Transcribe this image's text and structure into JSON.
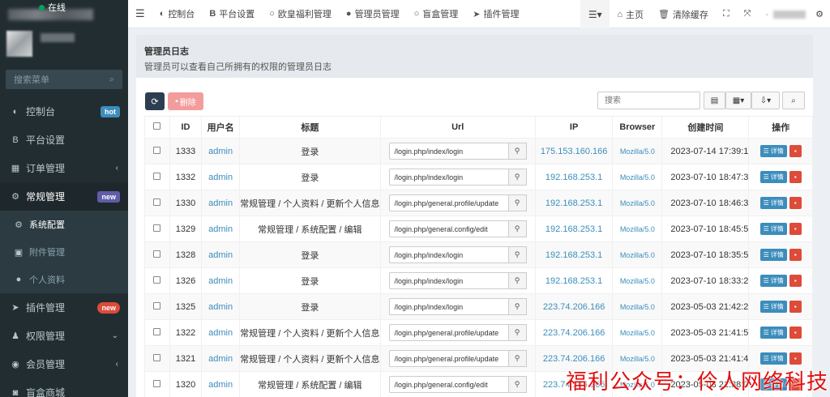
{
  "sidebar": {
    "status": "在线",
    "search_placeholder": "搜索菜单",
    "items": [
      {
        "icon": "dashboard-icon",
        "glyph": "◐",
        "label": "控制台",
        "badge": "hot"
      },
      {
        "icon": "bold-icon",
        "glyph": "B",
        "label": "平台设置"
      },
      {
        "icon": "table-icon",
        "glyph": "▦",
        "label": "订单管理",
        "caret": "‹"
      },
      {
        "icon": "cogs-icon",
        "glyph": "⚙",
        "label": "常规管理",
        "badge": "new"
      },
      {
        "icon": "cog-icon",
        "glyph": "⚙",
        "label": "系统配置",
        "sub": true,
        "current": true
      },
      {
        "icon": "file-image-icon",
        "glyph": "▣",
        "label": "附件管理",
        "sub": true
      },
      {
        "icon": "user-icon",
        "glyph": "●",
        "label": "个人资料",
        "sub": true
      },
      {
        "icon": "rocket-icon",
        "glyph": "➤",
        "label": "插件管理",
        "badge": "new"
      },
      {
        "icon": "group-icon",
        "glyph": "♟",
        "label": "权限管理",
        "caret": "⌄"
      },
      {
        "icon": "user-circle-icon",
        "glyph": "◉",
        "label": "会员管理",
        "caret": "‹"
      },
      {
        "icon": "shop-icon",
        "glyph": "◙",
        "label": "盲盒商城"
      }
    ]
  },
  "topnav": {
    "items": [
      {
        "icon": "dashboard-icon",
        "glyph": "◐",
        "label": "控制台"
      },
      {
        "icon": "bold-icon",
        "glyph": "B",
        "label": "平台设置"
      },
      {
        "icon": "circle-icon",
        "glyph": "○",
        "label": "欧皇福利管理"
      },
      {
        "icon": "user-icon",
        "glyph": "●",
        "label": "管理员管理"
      },
      {
        "icon": "circle-icon",
        "glyph": "○",
        "label": "盲盒管理"
      },
      {
        "icon": "rocket-icon",
        "glyph": "➤",
        "label": "插件管理"
      }
    ],
    "home_label": "主页",
    "clear_cache_label": "清除缓存"
  },
  "page": {
    "title": "管理员日志",
    "subtitle": "管理员可以查看自己所拥有的权限的管理员日志"
  },
  "toolbar": {
    "delete_label": "删除",
    "search_placeholder": "搜索"
  },
  "table": {
    "headers": [
      "ID",
      "用户名",
      "标题",
      "Url",
      "IP",
      "Browser",
      "创建时间",
      "操作"
    ],
    "detail_label": "详情",
    "rows": [
      {
        "id": "1333",
        "user": "admin",
        "title": "登录",
        "url": "/login.php/index/login",
        "ip": "175.153.160.166",
        "browser": "Mozilla/5.0",
        "time": "2023-07-14 17:39:1"
      },
      {
        "id": "1332",
        "user": "admin",
        "title": "登录",
        "url": "/login.php/index/login",
        "ip": "192.168.253.1",
        "browser": "Mozilla/5.0",
        "time": "2023-07-10 18:47:3"
      },
      {
        "id": "1330",
        "user": "admin",
        "title": "常规管理 / 个人资料 / 更新个人信息",
        "url": "/login.php/general.profile/update",
        "ip": "192.168.253.1",
        "browser": "Mozilla/5.0",
        "time": "2023-07-10 18:46:3"
      },
      {
        "id": "1329",
        "user": "admin",
        "title": "常规管理 / 系统配置 / 编辑",
        "url": "/login.php/general.config/edit",
        "ip": "192.168.253.1",
        "browser": "Mozilla/5.0",
        "time": "2023-07-10 18:45:5"
      },
      {
        "id": "1328",
        "user": "admin",
        "title": "登录",
        "url": "/login.php/index/login",
        "ip": "192.168.253.1",
        "browser": "Mozilla/5.0",
        "time": "2023-07-10 18:35:5"
      },
      {
        "id": "1326",
        "user": "admin",
        "title": "登录",
        "url": "/login.php/index/login",
        "ip": "192.168.253.1",
        "browser": "Mozilla/5.0",
        "time": "2023-07-10 18:33:2"
      },
      {
        "id": "1325",
        "user": "admin",
        "title": "登录",
        "url": "/login.php/index/login",
        "ip": "223.74.206.166",
        "browser": "Mozilla/5.0",
        "time": "2023-05-03 21:42:2"
      },
      {
        "id": "1322",
        "user": "admin",
        "title": "常规管理 / 个人资料 / 更新个人信息",
        "url": "/login.php/general.profile/update",
        "ip": "223.74.206.166",
        "browser": "Mozilla/5.0",
        "time": "2023-05-03 21:41:5"
      },
      {
        "id": "1321",
        "user": "admin",
        "title": "常规管理 / 个人资料 / 更新个人信息",
        "url": "/login.php/general.profile/update",
        "ip": "223.74.206.166",
        "browser": "Mozilla/5.0",
        "time": "2023-05-03 21:41:4"
      },
      {
        "id": "1320",
        "user": "admin",
        "title": "常规管理 / 系统配置 / 编辑",
        "url": "/login.php/general.config/edit",
        "ip": "223.74.206.166",
        "browser": "Mozilla/5.0",
        "time": "2023-05-03 21:38:0"
      }
    ]
  },
  "watermark": "福利公众号：伶人网络科技"
}
